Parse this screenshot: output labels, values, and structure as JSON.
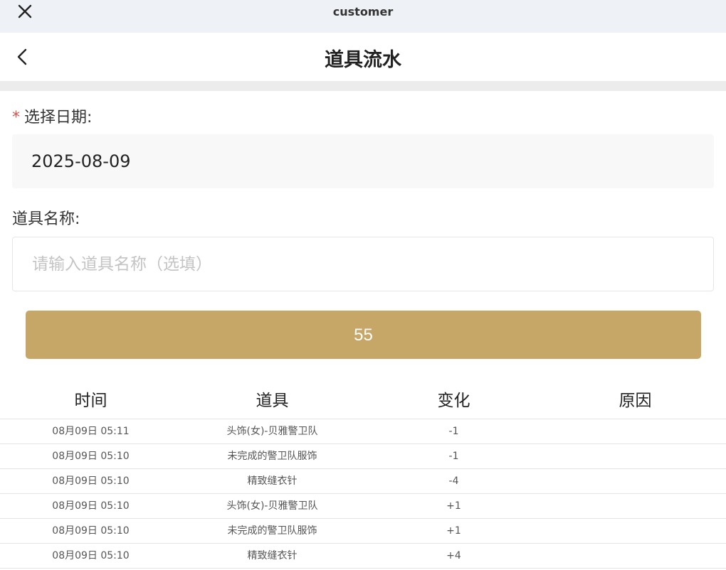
{
  "topbar": {
    "title": "customer",
    "close_icon": "close-icon"
  },
  "navbar": {
    "title": "道具流水",
    "back_icon": "chevron-left-icon"
  },
  "form": {
    "date_label_star": "*",
    "date_label": "选择日期:",
    "date_value": "2025-08-09",
    "name_label": "道具名称:",
    "name_placeholder": "请输入道具名称（选填）",
    "name_value": "",
    "submit_label": "55"
  },
  "colors": {
    "accent": "#c7a767",
    "required_star": "#d9534f"
  },
  "table": {
    "headers": [
      "时间",
      "道具",
      "变化",
      "原因"
    ],
    "rows": [
      {
        "time": "08月09日 05:11",
        "item": "头饰(女)-贝雅警卫队",
        "change": "-1",
        "reason": ""
      },
      {
        "time": "08月09日 05:10",
        "item": "未完成的警卫队服饰",
        "change": "-1",
        "reason": ""
      },
      {
        "time": "08月09日 05:10",
        "item": "精致缝衣针",
        "change": "-4",
        "reason": ""
      },
      {
        "time": "08月09日 05:10",
        "item": "头饰(女)-贝雅警卫队",
        "change": "+1",
        "reason": ""
      },
      {
        "time": "08月09日 05:10",
        "item": "未完成的警卫队服饰",
        "change": "+1",
        "reason": ""
      },
      {
        "time": "08月09日 05:10",
        "item": "精致缝衣针",
        "change": "+4",
        "reason": ""
      }
    ]
  }
}
